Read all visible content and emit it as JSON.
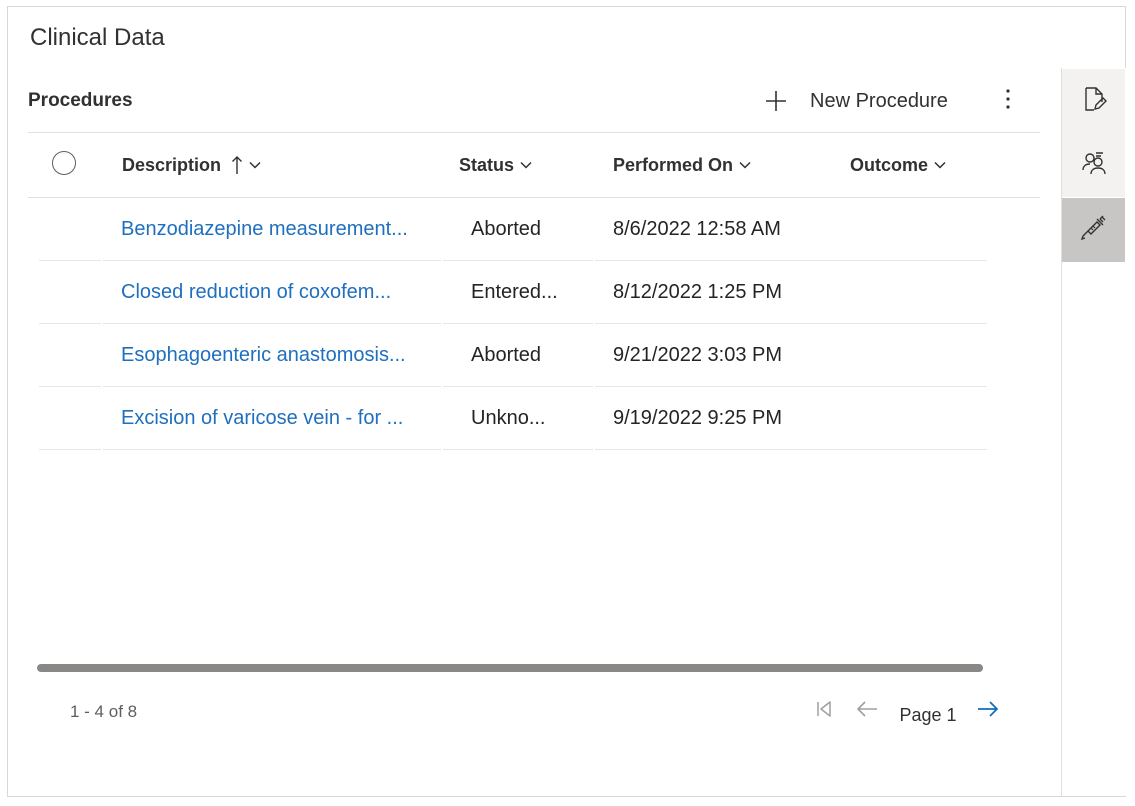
{
  "page": {
    "title": "Clinical Data"
  },
  "panel": {
    "title": "Procedures",
    "new_label": "New Procedure"
  },
  "columns": {
    "description": "Description",
    "status": "Status",
    "performed_on": "Performed On",
    "outcome": "Outcome"
  },
  "rows": [
    {
      "description": "Benzodiazepine measurement...",
      "status": "Aborted",
      "performed_on": "8/6/2022 12:58 AM",
      "outcome": ""
    },
    {
      "description": "Closed reduction of coxofem...",
      "status": "Entered...",
      "performed_on": "8/12/2022 1:25 PM",
      "outcome": ""
    },
    {
      "description": "Esophagoenteric anastomosis...",
      "status": "Aborted",
      "performed_on": "9/21/2022 3:03 PM",
      "outcome": ""
    },
    {
      "description": "Excision of varicose vein - for ...",
      "status": "Unkno...",
      "performed_on": "9/19/2022 9:25 PM",
      "outcome": ""
    }
  ],
  "pager": {
    "count": "1 - 4 of 8",
    "page_label": "Page 1"
  },
  "rail": {
    "icons": [
      "document-edit-icon",
      "people-icon",
      "syringe-icon"
    ]
  },
  "colors": {
    "link": "#1f6fbf",
    "accent": "#0f6cbd",
    "rail_selected": "#c8c6c4"
  }
}
